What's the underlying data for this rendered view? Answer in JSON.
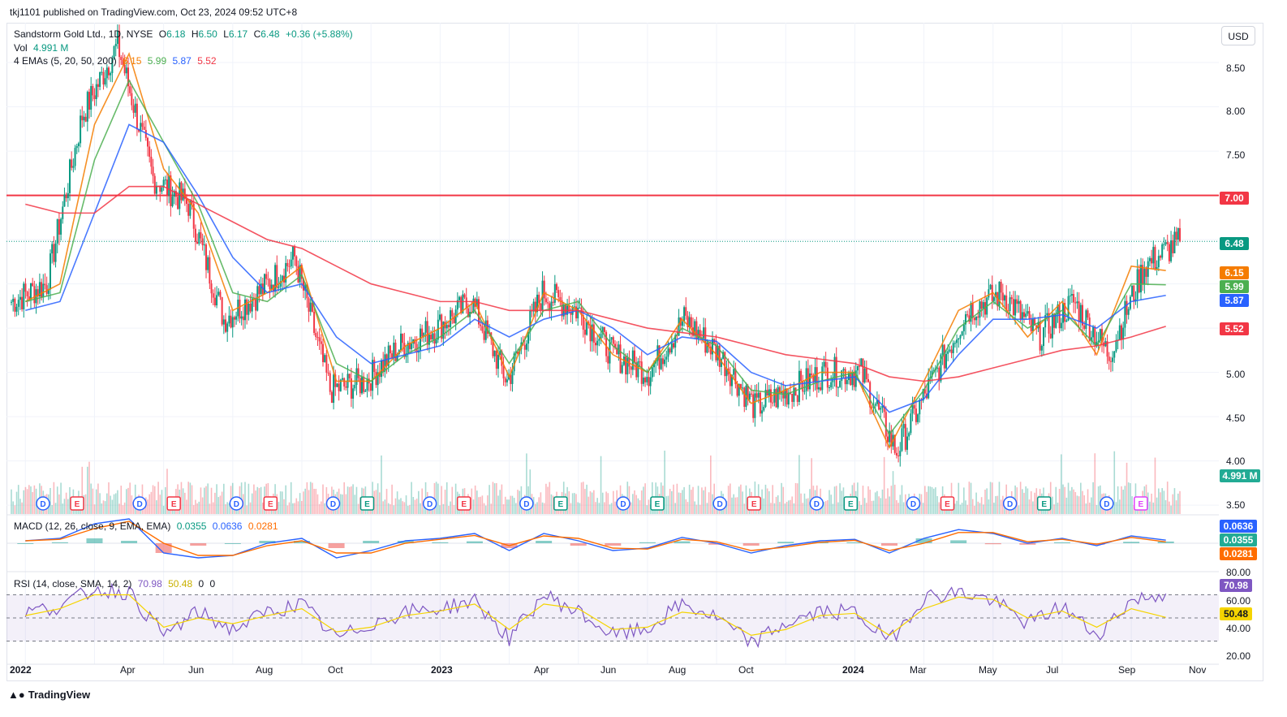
{
  "publisher_line": "tkj1101 published on TradingView.com, Oct 23, 2024 09:52 UTC+8",
  "footer_brand": "TradingView",
  "currency_button": "USD",
  "colors": {
    "ema5": "#f57c00",
    "ema20": "#4caf50",
    "ema50": "#2962ff",
    "ema200": "#f23645",
    "up": "#089981",
    "down": "#f23645",
    "rsi": "#7e57c2",
    "rsi_ma": "#f5d400",
    "macd": "#2962ff",
    "signal": "#ff6d00",
    "hline": "#f23645"
  },
  "legend": {
    "symbol": "Sandstorm Gold Ltd., 1D, NYSE",
    "open_label": "O",
    "open": "6.18",
    "high_label": "H",
    "high": "6.50",
    "low_label": "L",
    "low": "6.17",
    "close_label": "C",
    "close": "6.48",
    "change": "+0.36 (+5.88%)",
    "vol_label": "Vol",
    "vol": "4.991 M",
    "ema_label": "4 EMAs (5, 20, 50, 200)",
    "ema5": "6.15",
    "ema20": "5.99",
    "ema50": "5.87",
    "ema200": "5.52"
  },
  "macd_legend": {
    "label": "MACD (12, 26, close, 9, EMA, EMA)",
    "hist": "0.0355",
    "macd": "0.0636",
    "signal": "0.0281"
  },
  "rsi_legend": {
    "label": "RSI (14, close, SMA, 14, 2)",
    "rsi": "70.98",
    "ma": "50.48",
    "extra1": "0",
    "extra2": "0"
  },
  "price_tags": {
    "hline": "7.00",
    "last": "6.48",
    "ema5": "6.15",
    "ema20": "5.99",
    "ema50": "5.87",
    "ema200": "5.52",
    "vol": "4.991 M"
  },
  "macd_tags": {
    "macd": "0.0636",
    "hist": "0.0355",
    "signal": "0.0281"
  },
  "rsi_tags": {
    "rsi": "70.98",
    "ma": "50.48"
  },
  "price_ticks": [
    "8.50",
    "8.00",
    "7.50",
    "5.00",
    "4.50",
    "4.00",
    "3.50"
  ],
  "rsi_ticks": [
    "80.00",
    "60.00",
    "40.00",
    "20.00"
  ],
  "x_labels": [
    {
      "t": "2022",
      "bold": true
    },
    {
      "t": "Apr",
      "bold": false
    },
    {
      "t": "Jun",
      "bold": false
    },
    {
      "t": "Aug",
      "bold": false
    },
    {
      "t": "Oct",
      "bold": false
    },
    {
      "t": "2023",
      "bold": true
    },
    {
      "t": "Apr",
      "bold": false
    },
    {
      "t": "Jun",
      "bold": false
    },
    {
      "t": "Aug",
      "bold": false
    },
    {
      "t": "Oct",
      "bold": false
    },
    {
      "t": "2024",
      "bold": true
    },
    {
      "t": "Mar",
      "bold": false
    },
    {
      "t": "May",
      "bold": false
    },
    {
      "t": "Jul",
      "bold": false
    },
    {
      "t": "Sep",
      "bold": false
    },
    {
      "t": "Nov",
      "bold": false
    }
  ],
  "event_markers": [
    {
      "letter": "D",
      "kind": "dividend"
    },
    {
      "letter": "E",
      "kind": "earnings"
    },
    {
      "letter": "D",
      "kind": "dividend"
    },
    {
      "letter": "E",
      "kind": "earnings"
    },
    {
      "letter": "D",
      "kind": "dividend"
    },
    {
      "letter": "E",
      "kind": "earnings"
    },
    {
      "letter": "D",
      "kind": "dividend"
    },
    {
      "letter": "E",
      "kind": "earnings-beat"
    },
    {
      "letter": "D",
      "kind": "dividend"
    },
    {
      "letter": "E",
      "kind": "earnings"
    },
    {
      "letter": "D",
      "kind": "dividend"
    },
    {
      "letter": "E",
      "kind": "earnings-beat"
    },
    {
      "letter": "D",
      "kind": "dividend"
    },
    {
      "letter": "E",
      "kind": "earnings-beat"
    },
    {
      "letter": "D",
      "kind": "dividend"
    },
    {
      "letter": "E",
      "kind": "earnings"
    },
    {
      "letter": "D",
      "kind": "dividend"
    },
    {
      "letter": "E",
      "kind": "earnings-beat"
    },
    {
      "letter": "D",
      "kind": "dividend"
    },
    {
      "letter": "E",
      "kind": "earnings"
    },
    {
      "letter": "D",
      "kind": "dividend"
    },
    {
      "letter": "E",
      "kind": "earnings-beat"
    },
    {
      "letter": "D",
      "kind": "dividend"
    },
    {
      "letter": "E",
      "kind": "earnings-upcoming"
    }
  ],
  "chart_data": {
    "type": "line",
    "title": "Sandstorm Gold Ltd., 1D, NYSE",
    "x": [
      "2022-01",
      "2022-02",
      "2022-03",
      "2022-04",
      "2022-05",
      "2022-06",
      "2022-07",
      "2022-08",
      "2022-09",
      "2022-10",
      "2022-11",
      "2022-12",
      "2023-01",
      "2023-02",
      "2023-03",
      "2023-04",
      "2023-05",
      "2023-06",
      "2023-07",
      "2023-08",
      "2023-09",
      "2023-10",
      "2023-11",
      "2023-12",
      "2024-01",
      "2024-02",
      "2024-03",
      "2024-04",
      "2024-05",
      "2024-06",
      "2024-07",
      "2024-08",
      "2024-09",
      "2024-10"
    ],
    "series": [
      {
        "name": "Sandstorm Gold Ltd.",
        "values": [
          5.8,
          6.0,
          7.9,
          8.7,
          7.2,
          6.9,
          5.6,
          5.9,
          6.3,
          4.8,
          4.9,
          5.3,
          5.5,
          5.8,
          4.9,
          5.9,
          5.7,
          5.2,
          5.0,
          5.6,
          5.2,
          4.6,
          4.8,
          5.0,
          5.0,
          4.1,
          4.9,
          5.7,
          5.9,
          5.4,
          5.8,
          5.2,
          6.2,
          6.48
        ]
      },
      {
        "name": "EMA 5",
        "values": [
          5.8,
          6.0,
          7.8,
          8.6,
          7.3,
          6.8,
          5.7,
          5.9,
          6.2,
          4.9,
          4.9,
          5.3,
          5.5,
          5.8,
          4.95,
          5.9,
          5.7,
          5.2,
          5.0,
          5.6,
          5.2,
          4.65,
          4.8,
          5.0,
          5.0,
          4.15,
          4.9,
          5.7,
          5.9,
          5.4,
          5.8,
          5.2,
          6.2,
          6.15
        ]
      },
      {
        "name": "EMA 20",
        "values": [
          5.8,
          5.9,
          7.4,
          8.3,
          7.6,
          6.9,
          5.9,
          5.8,
          6.1,
          5.1,
          4.9,
          5.2,
          5.4,
          5.7,
          5.1,
          5.7,
          5.8,
          5.3,
          5.0,
          5.5,
          5.3,
          4.8,
          4.75,
          4.9,
          5.0,
          4.3,
          4.8,
          5.5,
          5.8,
          5.5,
          5.7,
          5.3,
          6.0,
          5.99
        ]
      },
      {
        "name": "EMA 50",
        "values": [
          5.7,
          5.8,
          6.8,
          7.8,
          7.6,
          7.0,
          6.3,
          5.9,
          6.0,
          5.4,
          5.1,
          5.2,
          5.3,
          5.6,
          5.4,
          5.6,
          5.7,
          5.5,
          5.2,
          5.4,
          5.35,
          5.0,
          4.85,
          4.9,
          4.95,
          4.55,
          4.7,
          5.2,
          5.6,
          5.6,
          5.65,
          5.5,
          5.8,
          5.87
        ]
      },
      {
        "name": "EMA 200",
        "values": [
          6.9,
          6.8,
          6.8,
          7.1,
          7.1,
          6.9,
          6.7,
          6.5,
          6.4,
          6.2,
          6.0,
          5.9,
          5.8,
          5.8,
          5.7,
          5.7,
          5.7,
          5.6,
          5.5,
          5.45,
          5.4,
          5.3,
          5.2,
          5.15,
          5.1,
          4.95,
          4.9,
          4.95,
          5.05,
          5.15,
          5.25,
          5.3,
          5.4,
          5.52
        ]
      }
    ],
    "volume_last": "4.991 M",
    "horizontal_line": 7.0,
    "last_price": 6.48,
    "ylim": [
      3.4,
      8.95
    ],
    "xlabel": "",
    "ylabel": "",
    "grid": true,
    "macd": {
      "macd": [
        0.05,
        0.1,
        0.4,
        0.5,
        -0.2,
        -0.3,
        -0.25,
        0.0,
        0.1,
        -0.3,
        -0.15,
        0.05,
        0.1,
        0.2,
        -0.15,
        0.2,
        0.05,
        -0.15,
        -0.1,
        0.12,
        0.0,
        -0.2,
        -0.05,
        0.05,
        0.08,
        -0.2,
        0.1,
        0.28,
        0.2,
        0.0,
        0.1,
        -0.05,
        0.15,
        0.0636
      ],
      "signal": [
        0.05,
        0.08,
        0.3,
        0.45,
        0.0,
        -0.25,
        -0.25,
        -0.05,
        0.05,
        -0.2,
        -0.2,
        0.0,
        0.08,
        0.16,
        -0.05,
        0.15,
        0.1,
        -0.1,
        -0.12,
        0.08,
        0.03,
        -0.15,
        -0.08,
        0.02,
        0.06,
        -0.15,
        0.0,
        0.22,
        0.22,
        0.03,
        0.08,
        -0.02,
        0.12,
        0.0281
      ],
      "hist_last": 0.0355
    },
    "rsi": {
      "rsi": [
        55,
        60,
        75,
        72,
        35,
        55,
        40,
        55,
        62,
        32,
        45,
        55,
        58,
        65,
        32,
        70,
        55,
        35,
        40,
        62,
        50,
        28,
        45,
        55,
        55,
        30,
        68,
        72,
        65,
        45,
        60,
        35,
        65,
        70.98
      ],
      "ma": [
        52,
        58,
        70,
        70,
        42,
        50,
        45,
        52,
        58,
        38,
        42,
        52,
        56,
        62,
        40,
        62,
        58,
        40,
        42,
        55,
        52,
        35,
        40,
        52,
        54,
        35,
        58,
        68,
        66,
        50,
        56,
        42,
        58,
        50.48
      ],
      "overbought": 70,
      "oversold": 30
    },
    "legend": "top-left"
  }
}
